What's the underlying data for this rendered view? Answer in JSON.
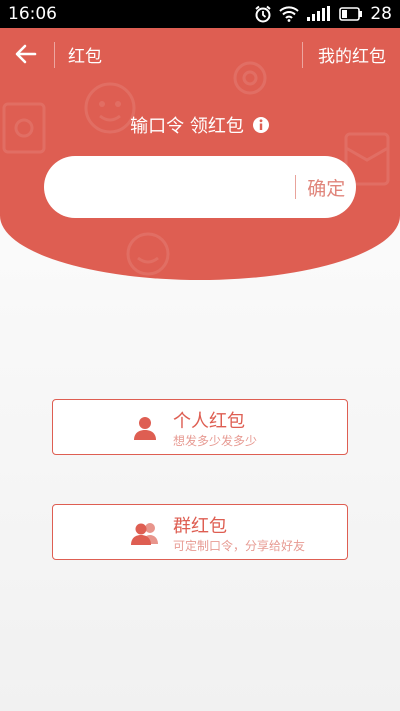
{
  "status_bar": {
    "time": "16:06",
    "battery": "28"
  },
  "nav": {
    "title": "红包",
    "my_envelopes": "我的红包"
  },
  "prompt": {
    "text": "输口令 领红包"
  },
  "code_input": {
    "value": "",
    "placeholder": "",
    "confirm_label": "确定"
  },
  "options": [
    {
      "title": "个人红包",
      "subtitle": "想发多少发多少",
      "icon": "person-icon"
    },
    {
      "title": "群红包",
      "subtitle": "可定制口令，分享给好友",
      "icon": "group-icon"
    }
  ],
  "colors": {
    "accent": "#de5e52",
    "background": "#f4f4f4",
    "muted_accent": "#e79b93"
  }
}
